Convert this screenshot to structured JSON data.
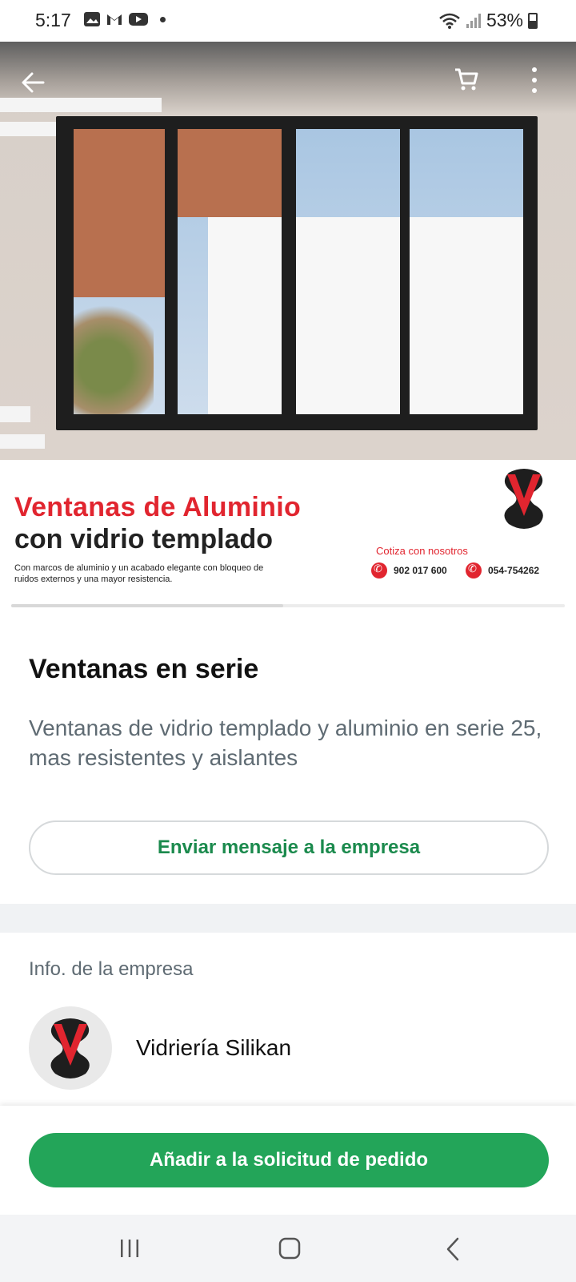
{
  "status_bar": {
    "time": "5:17",
    "battery": "53%"
  },
  "banner": {
    "title_line1": "Ventanas de Aluminio",
    "title_line2": "con vidrio templado",
    "description": "Con marcos de aluminio y un acabado elegante con bloqueo de ruidos externos y una mayor resistencia.",
    "cta": "Cotiza con nosotros",
    "phone1": "902 017 600",
    "phone2": "054-754262"
  },
  "product": {
    "title": "Ventanas en serie",
    "description": "Ventanas de vidrio templado y aluminio en serie 25, mas resistentes y aislantes",
    "message_button": "Enviar mensaje a la empresa"
  },
  "company_info": {
    "section_label": "Info. de la empresa",
    "name": "Vidriería Silikan"
  },
  "order_button": "Añadir a la solicitud de pedido",
  "colors": {
    "accent_green": "#23a559",
    "text_green": "#1b8a4d",
    "brand_red": "#e1252f"
  }
}
